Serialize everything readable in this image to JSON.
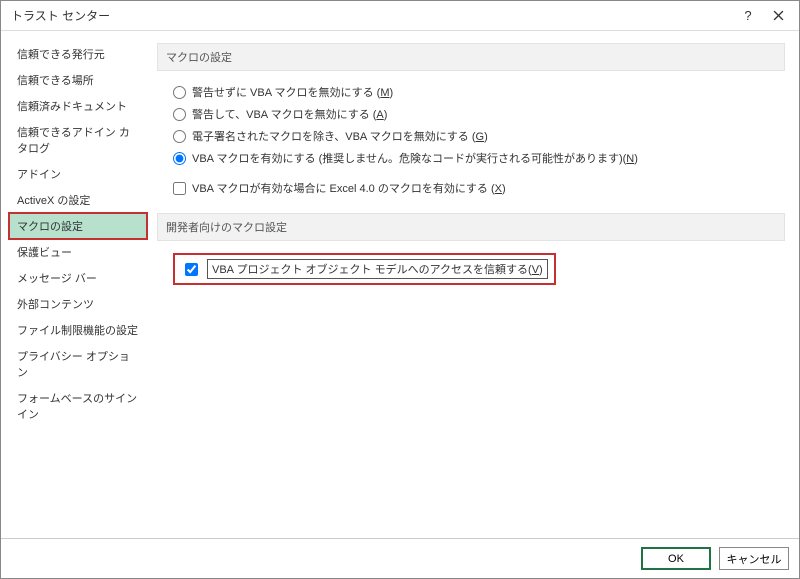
{
  "title": "トラスト センター",
  "sidebar": {
    "items": [
      {
        "label": "信頼できる発行元"
      },
      {
        "label": "信頼できる場所"
      },
      {
        "label": "信頼済みドキュメント"
      },
      {
        "label": "信頼できるアドイン カタログ"
      },
      {
        "label": "アドイン"
      },
      {
        "label": "ActiveX の設定"
      },
      {
        "label": "マクロの設定"
      },
      {
        "label": "保護ビュー"
      },
      {
        "label": "メッセージ バー"
      },
      {
        "label": "外部コンテンツ"
      },
      {
        "label": "ファイル制限機能の設定"
      },
      {
        "label": "プライバシー オプション"
      },
      {
        "label": "フォームベースのサインイン"
      }
    ],
    "selected_index": 6
  },
  "sections": {
    "macro_settings_header": "マクロの設定",
    "radio_options": [
      {
        "label": "警告せずに VBA マクロを無効にする (",
        "key": "M",
        "tail": ")"
      },
      {
        "label": "警告して、VBA マクロを無効にする (",
        "key": "A",
        "tail": ")"
      },
      {
        "label": "電子署名されたマクロを除き、VBA マクロを無効にする (",
        "key": "G",
        "tail": ")"
      },
      {
        "label": "VBA マクロを有効にする (推奨しません。危険なコードが実行される可能性があります)(",
        "key": "N",
        "tail": ")"
      }
    ],
    "radio_selected_index": 3,
    "excel4_checkbox": {
      "label": "VBA マクロが有効な場合に Excel 4.0 のマクロを有効にする (",
      "key": "X",
      "tail": ")",
      "checked": false
    },
    "dev_header": "開発者向けのマクロ設定",
    "trust_vba_checkbox": {
      "label": "VBA プロジェクト オブジェクト モデルへのアクセスを信頼する(",
      "key": "V",
      "tail": ")",
      "checked": true
    }
  },
  "footer": {
    "ok": "OK",
    "cancel": "キャンセル"
  }
}
